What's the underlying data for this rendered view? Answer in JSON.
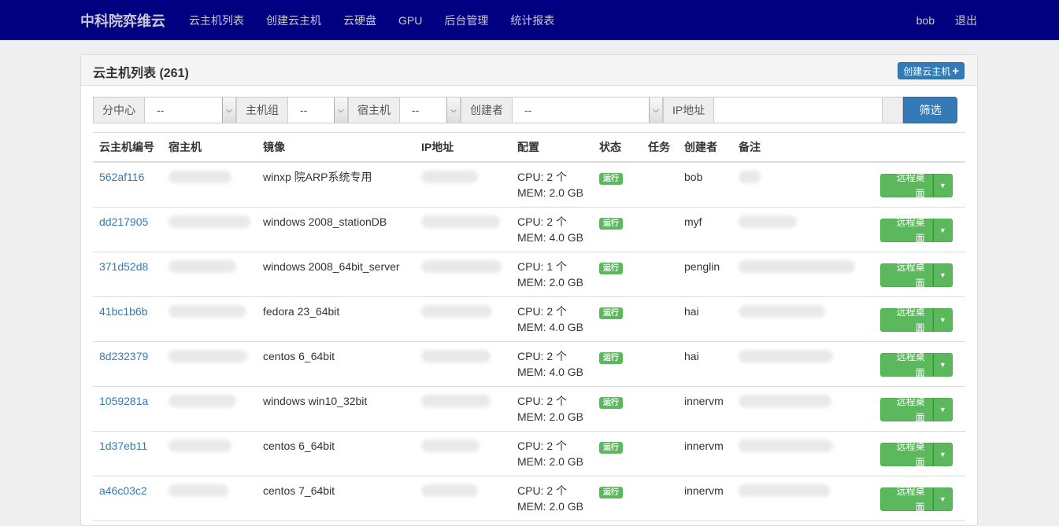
{
  "nav": {
    "brand": "中科院弈维云",
    "links": [
      "云主机列表",
      "创建云主机",
      "云硬盘",
      "GPU",
      "后台管理",
      "统计报表"
    ],
    "user": "bob",
    "logout": "退出"
  },
  "panel": {
    "title": "云主机列表 (261)",
    "create_button": "创建云主机"
  },
  "filter": {
    "center_label": "分中心",
    "center_value": "--",
    "group_label": "主机组",
    "group_value": "--",
    "host_label": "宿主机",
    "host_value": "--",
    "creator_label": "创建者",
    "creator_value": "--",
    "ip_label": "IP地址",
    "ip_value": "",
    "submit": "筛选"
  },
  "table": {
    "headers": [
      "云主机编号",
      "宿主机",
      "镜像",
      "IP地址",
      "配置",
      "状态",
      "任务",
      "创建者",
      "备注"
    ],
    "rows": [
      {
        "id": "562af116",
        "image": "winxp 院ARP系统专用",
        "cpu": "CPU: 2 个",
        "mem": "MEM: 2.0 GB",
        "status": "运行",
        "creator": "bob",
        "action": "远程桌面"
      },
      {
        "id": "dd217905",
        "image": "windows 2008_stationDB",
        "cpu": "CPU: 2 个",
        "mem": "MEM: 4.0 GB",
        "status": "运行",
        "creator": "myf",
        "action": "远程桌面"
      },
      {
        "id": "371d52d8",
        "image": "windows 2008_64bit_server",
        "cpu": "CPU: 1 个",
        "mem": "MEM: 2.0 GB",
        "status": "运行",
        "creator": "penglin",
        "action": "远程桌面"
      },
      {
        "id": "41bc1b6b",
        "image": "fedora 23_64bit",
        "cpu": "CPU: 2 个",
        "mem": "MEM: 4.0 GB",
        "status": "运行",
        "creator": "hai",
        "action": "远程桌面"
      },
      {
        "id": "8d232379",
        "image": "centos 6_64bit",
        "cpu": "CPU: 2 个",
        "mem": "MEM: 4.0 GB",
        "status": "运行",
        "creator": "hai",
        "action": "远程桌面"
      },
      {
        "id": "1059281a",
        "image": "windows win10_32bit",
        "cpu": "CPU: 2 个",
        "mem": "MEM: 2.0 GB",
        "status": "运行",
        "creator": "innervm",
        "action": "远程桌面"
      },
      {
        "id": "1d37eb11",
        "image": "centos 6_64bit",
        "cpu": "CPU: 2 个",
        "mem": "MEM: 2.0 GB",
        "status": "运行",
        "creator": "innervm",
        "action": "远程桌面"
      },
      {
        "id": "a46c03c2",
        "image": "centos 7_64bit",
        "cpu": "CPU: 2 个",
        "mem": "MEM: 2.0 GB",
        "status": "运行",
        "creator": "innervm",
        "action": "远程桌面"
      }
    ]
  }
}
